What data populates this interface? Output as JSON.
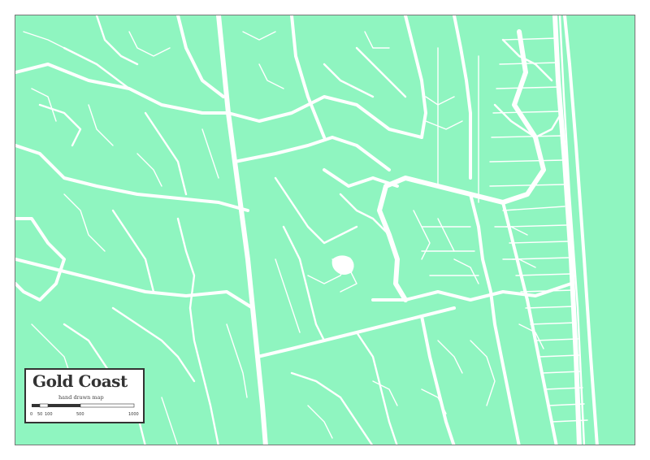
{
  "map": {
    "title": "Gold Coast",
    "subtitle": "hand drawn map",
    "colors": {
      "land": "#8ff5c0",
      "ocean": "#8ff5c0",
      "roads": "#ffffff",
      "frame": "#777777",
      "text": "#333333"
    },
    "scale_bar": {
      "labels": [
        "0",
        "50",
        "100",
        "500",
        "1000"
      ]
    }
  }
}
